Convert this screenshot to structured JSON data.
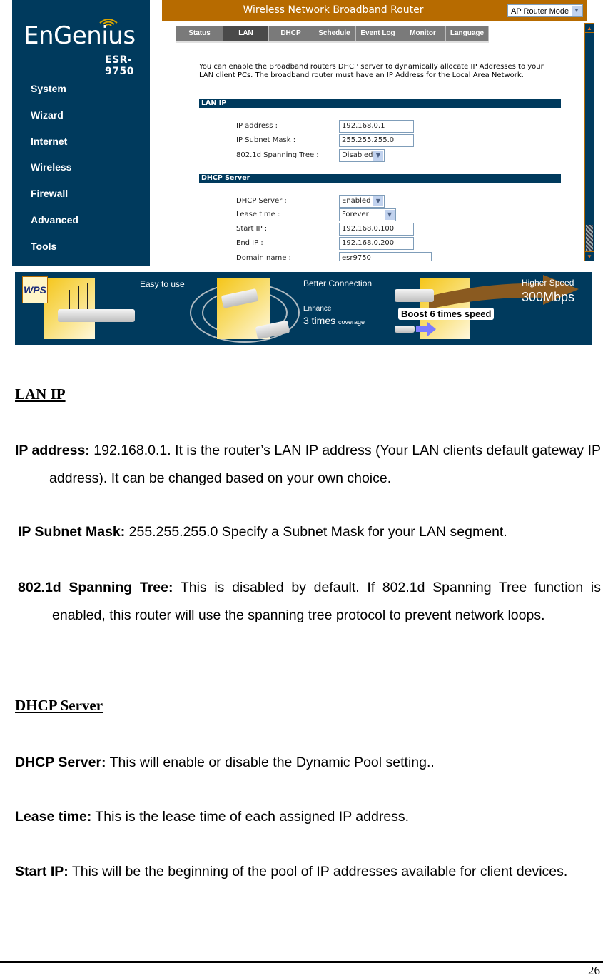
{
  "router_ui": {
    "brand": "EnGenius",
    "model": "ESR-9750",
    "title": "Wireless Network Broadband Router",
    "mode_select": "AP Router Mode",
    "sidebar": [
      "System",
      "Wizard",
      "Internet",
      "Wireless",
      "Firewall",
      "Advanced",
      "Tools"
    ],
    "tabs": [
      {
        "label": "Status",
        "active": false
      },
      {
        "label": "LAN",
        "active": true
      },
      {
        "label": "DHCP",
        "active": false
      },
      {
        "label": "Schedule",
        "active": false
      },
      {
        "label": "Event Log",
        "active": false
      },
      {
        "label": "Monitor",
        "active": false
      },
      {
        "label": "Language",
        "active": false
      }
    ],
    "intro": "You can enable the Broadband routers DHCP server to dynamically allocate IP Addresses to your LAN client PCs. The broadband router must have an IP Address for the Local Area Network.",
    "lan_ip": {
      "section": "LAN IP",
      "ip_label": "IP address :",
      "ip_value": "192.168.0.1",
      "mask_label": "IP Subnet Mask :",
      "mask_value": "255.255.255.0",
      "stp_label": "802.1d Spanning Tree :",
      "stp_value": "Disabled"
    },
    "dhcp": {
      "section": "DHCP Server",
      "server_label": "DHCP Server :",
      "server_value": "Enabled",
      "lease_label": "Lease time :",
      "lease_value": "Forever",
      "start_label": "Start IP :",
      "start_value": "192.168.0.100",
      "end_label": "End IP :",
      "end_value": "192.168.0.200",
      "domain_label": "Domain name :",
      "domain_value": "esr9750"
    }
  },
  "banner": {
    "wps": "WPS",
    "easy": "Easy to use",
    "better": "Better Connection",
    "enhance": "Enhance",
    "times": "3 times",
    "coverage": "coverage",
    "higher": "Higher Speed",
    "speed": "300Mbps",
    "boost": "Boost 6 times speed"
  },
  "doc": {
    "lan_heading": "LAN IP",
    "ip_term": "IP address:",
    "ip_text": " 192.168.0.1. It is the router’s LAN IP address (Your LAN clients default gateway IP address). It can be changed based on your own choice.",
    "mask_term": "IP Subnet Mask:",
    "mask_text": " 255.255.255.0 Specify a Subnet Mask for your LAN segment.",
    "stp_term": "802.1d Spanning Tree:",
    "stp_text": " This is disabled by default. If 802.1d Spanning Tree function is enabled, this router will use the spanning tree protocol to prevent network loops.",
    "dhcp_heading": "DHCP Server",
    "dhcp_term": "DHCP Server:",
    "dhcp_text": " This will enable or disable the Dynamic Pool setting..",
    "lease_term": "Lease time:",
    "lease_text": " This is the lease time of each assigned IP address.",
    "start_term": "Start IP:",
    "start_text": " This will be the beginning of the pool of IP addresses available for client devices.",
    "page_number": "26"
  },
  "colors": {
    "navy": "#003a5d",
    "orange": "#b76b00",
    "tab_gray": "#7a7a7a",
    "tab_active": "#4a4a4a"
  }
}
